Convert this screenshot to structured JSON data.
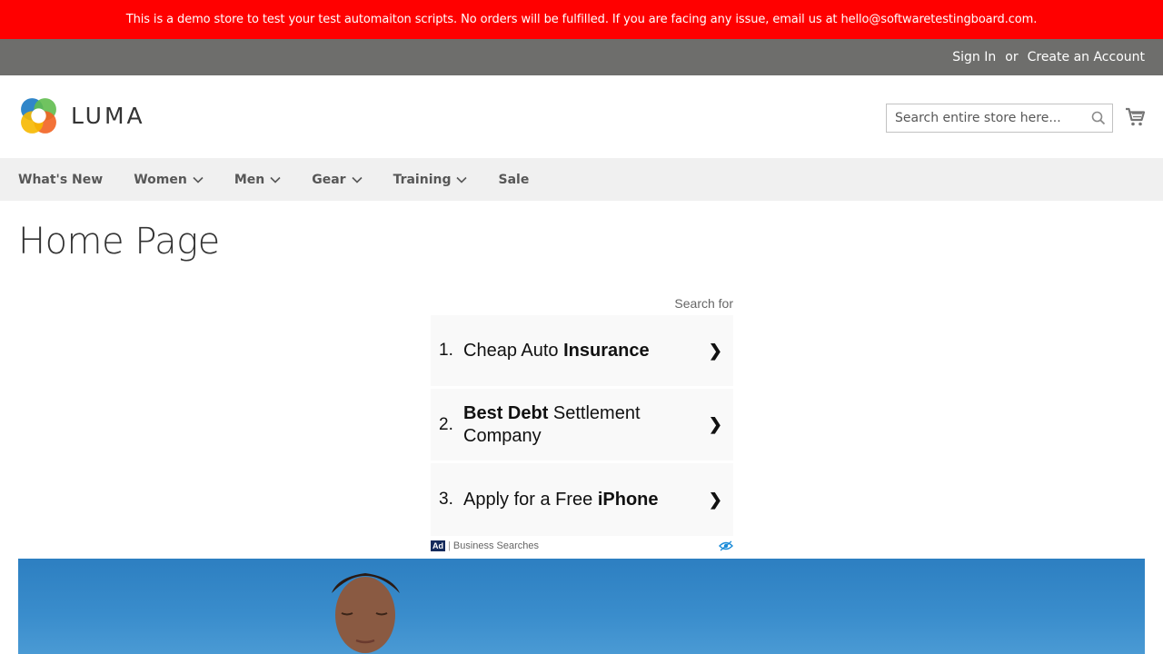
{
  "banner": {
    "text": "This is a demo store to test your test automaiton scripts. No orders will be fulfilled. If you are facing any issue, email us at hello@softwaretestingboard.com."
  },
  "top_links": {
    "sign_in": "Sign In",
    "or": "or",
    "create_account": "Create an Account"
  },
  "header": {
    "logo_text": "LUMA",
    "search_placeholder": "Search entire store here..."
  },
  "nav": {
    "items": [
      {
        "label": "What's New"
      },
      {
        "label": "Women"
      },
      {
        "label": "Men"
      },
      {
        "label": "Gear"
      },
      {
        "label": "Training"
      },
      {
        "label": "Sale"
      }
    ]
  },
  "page": {
    "title": "Home Page"
  },
  "ad": {
    "search_for": "Search for",
    "items": [
      {
        "num": "1.",
        "normal_before": "Cheap Auto ",
        "bold": "Insurance",
        "normal_after": ""
      },
      {
        "num": "2.",
        "normal_before": "",
        "bold": "Best Debt",
        "normal_after": " Settlement Company"
      },
      {
        "num": "3.",
        "normal_before": "Apply for a Free ",
        "bold": "iPhone",
        "normal_after": ""
      }
    ],
    "arrow": "❯",
    "badge": "Ad",
    "footer_label": "Business Searches"
  },
  "colors": {
    "banner": "#ff0000",
    "top_bar": "#6e6e6c",
    "nav_bg": "#f0f0f0"
  }
}
